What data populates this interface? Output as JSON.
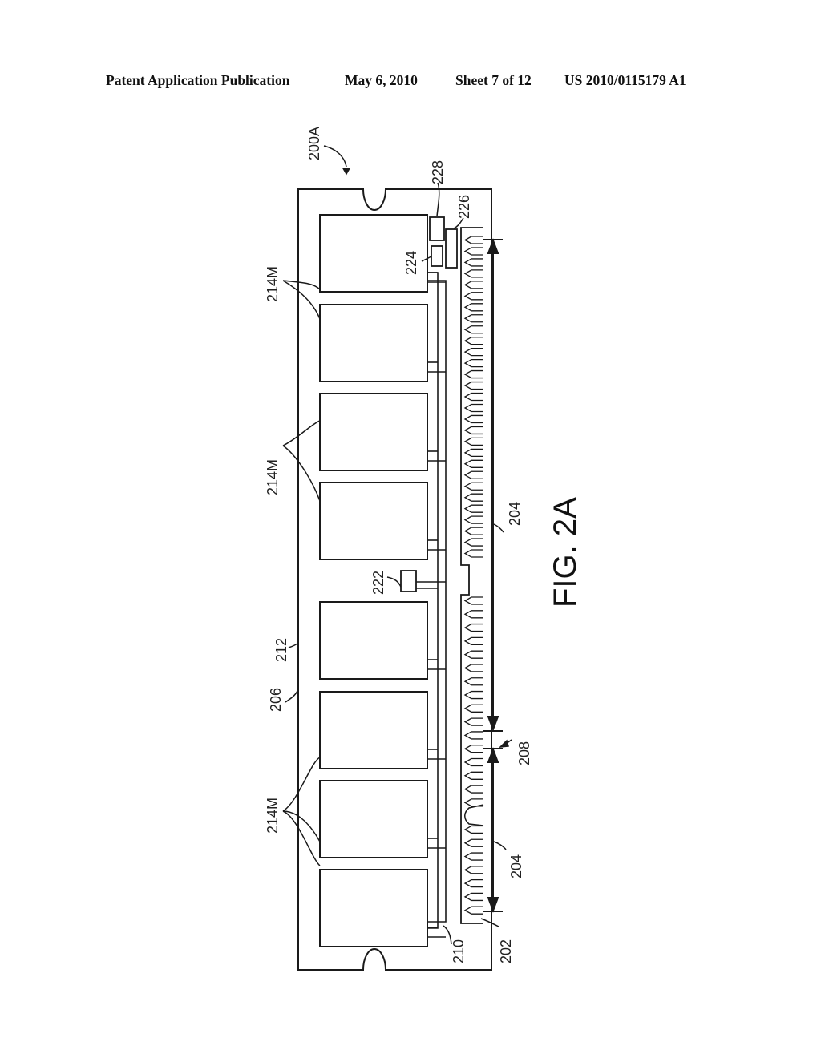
{
  "header": {
    "publication": "Patent Application Publication",
    "date": "May 6, 2010",
    "sheet": "Sheet 7 of 12",
    "patent_number": "US 2010/0115179 A1"
  },
  "figure": {
    "caption": "FIG. 2A",
    "labels": {
      "module": "200A",
      "pcb": "206",
      "surface": "212",
      "memory_devices": "214M",
      "connector_edge": "202",
      "contact_group": "204",
      "keying_notch": "208",
      "traces": "210",
      "component_222": "222",
      "component_224": "224",
      "component_226": "226",
      "component_228": "228"
    },
    "memory_chip_count": 8,
    "contact_pin_count_upper": 29,
    "contact_pin_count_lower": 23
  },
  "colors": {
    "ink": "#1a1a1a",
    "paper": "#ffffff"
  }
}
